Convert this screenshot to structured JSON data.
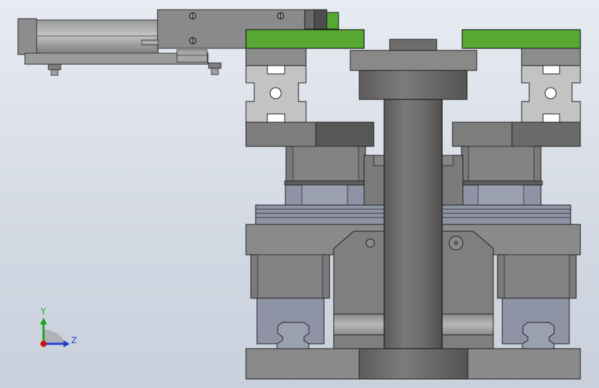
{
  "viewport": {
    "background_top": "#e7ebf2",
    "background_bottom": "#c9d0dc"
  },
  "colors": {
    "green": "#56a833",
    "green_dark": "#3d7d23",
    "steel": "#8c8c8c",
    "steel_dark": "#6b6b6b",
    "steel_light": "#b9b9b9",
    "rail_blue": "#8e94a5",
    "edge": "#2a2a2a",
    "column": "#6f6e6c",
    "bracket": "#c3c3c3"
  },
  "triad": {
    "icon": "coordinate-triad-icon",
    "y_label": "Y",
    "z_label": "Z",
    "y_color": "#1aa31a",
    "z_color": "#1f3fd6",
    "origin_color": "#d01010"
  }
}
